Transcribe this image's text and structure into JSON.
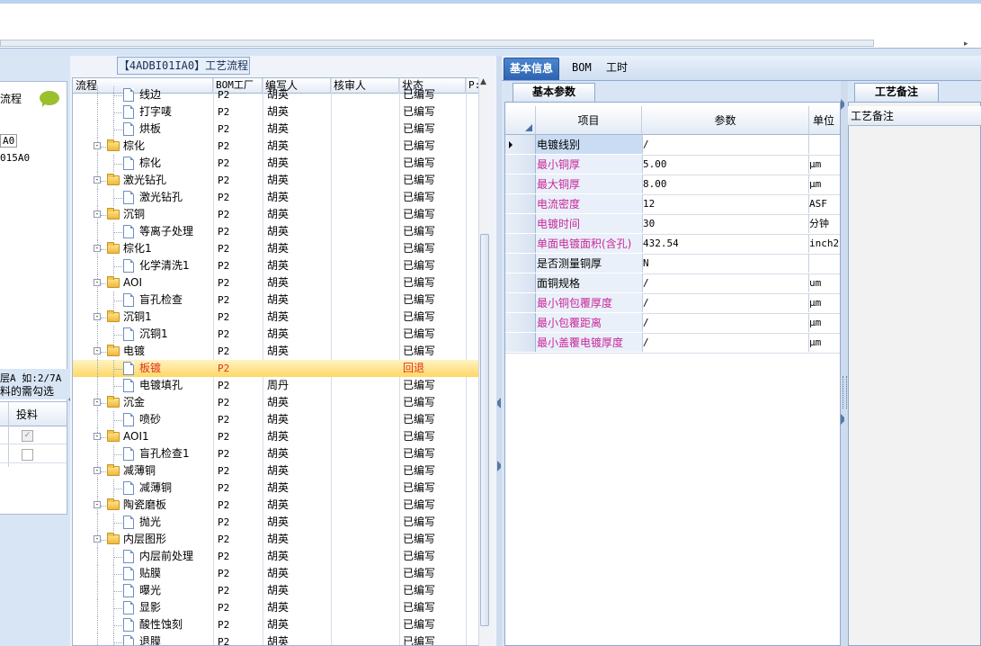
{
  "left": {
    "title_fragment": "流程",
    "line1": "A0",
    "line2": "015A0",
    "note1": "层A 如:2/7A",
    "note2": "料的需勾选",
    "col_header": "投料"
  },
  "tree": {
    "title": "【4ADBI01IA0】工艺流程",
    "columns": [
      "流程",
      "BOM工厂",
      "编写人",
      "核审人",
      "状态",
      "P:"
    ],
    "rows": [
      {
        "name": "线边",
        "level": 2,
        "type": "doc",
        "bom": "P2",
        "writer": "胡英",
        "reviewer": "",
        "status": "已编写"
      },
      {
        "name": "打字唛",
        "level": 2,
        "type": "doc",
        "bom": "P2",
        "writer": "胡英",
        "reviewer": "",
        "status": "已编写"
      },
      {
        "name": "烘板",
        "level": 2,
        "type": "doc",
        "bom": "P2",
        "writer": "胡英",
        "reviewer": "",
        "status": "已编写"
      },
      {
        "name": "棕化",
        "level": 1,
        "type": "folder",
        "bom": "P2",
        "writer": "胡英",
        "reviewer": "",
        "status": "已编写"
      },
      {
        "name": "棕化",
        "level": 2,
        "type": "doc",
        "bom": "P2",
        "writer": "胡英",
        "reviewer": "",
        "status": "已编写"
      },
      {
        "name": "激光钻孔",
        "level": 1,
        "type": "folder",
        "bom": "P2",
        "writer": "胡英",
        "reviewer": "",
        "status": "已编写"
      },
      {
        "name": "激光钻孔",
        "level": 2,
        "type": "doc",
        "bom": "P2",
        "writer": "胡英",
        "reviewer": "",
        "status": "已编写"
      },
      {
        "name": "沉铜",
        "level": 1,
        "type": "folder",
        "bom": "P2",
        "writer": "胡英",
        "reviewer": "",
        "status": "已编写"
      },
      {
        "name": "等离子处理",
        "level": 2,
        "type": "doc",
        "bom": "P2",
        "writer": "胡英",
        "reviewer": "",
        "status": "已编写"
      },
      {
        "name": "棕化1",
        "level": 1,
        "type": "folder",
        "bom": "P2",
        "writer": "胡英",
        "reviewer": "",
        "status": "已编写"
      },
      {
        "name": "化学清洗1",
        "level": 2,
        "type": "doc",
        "bom": "P2",
        "writer": "胡英",
        "reviewer": "",
        "status": "已编写"
      },
      {
        "name": "AOI",
        "level": 1,
        "type": "folder",
        "bom": "P2",
        "writer": "胡英",
        "reviewer": "",
        "status": "已编写"
      },
      {
        "name": "盲孔检查",
        "level": 2,
        "type": "doc",
        "bom": "P2",
        "writer": "胡英",
        "reviewer": "",
        "status": "已编写"
      },
      {
        "name": "沉铜1",
        "level": 1,
        "type": "folder",
        "bom": "P2",
        "writer": "胡英",
        "reviewer": "",
        "status": "已编写"
      },
      {
        "name": "沉铜1",
        "level": 2,
        "type": "doc",
        "bom": "P2",
        "writer": "胡英",
        "reviewer": "",
        "status": "已编写"
      },
      {
        "name": "电镀",
        "level": 1,
        "type": "folder",
        "bom": "P2",
        "writer": "胡英",
        "reviewer": "",
        "status": "已编写"
      },
      {
        "name": "板镀",
        "level": 2,
        "type": "doc",
        "bom": "P2",
        "writer": "",
        "reviewer": "",
        "status": "回退",
        "selected": true
      },
      {
        "name": "电镀填孔",
        "level": 2,
        "type": "doc",
        "bom": "P2",
        "writer": "周丹",
        "reviewer": "",
        "status": "已编写"
      },
      {
        "name": "沉金",
        "level": 1,
        "type": "folder",
        "bom": "P2",
        "writer": "胡英",
        "reviewer": "",
        "status": "已编写"
      },
      {
        "name": "喷砂",
        "level": 2,
        "type": "doc",
        "bom": "P2",
        "writer": "胡英",
        "reviewer": "",
        "status": "已编写"
      },
      {
        "name": "AOI1",
        "level": 1,
        "type": "folder",
        "bom": "P2",
        "writer": "胡英",
        "reviewer": "",
        "status": "已编写"
      },
      {
        "name": "盲孔检查1",
        "level": 2,
        "type": "doc",
        "bom": "P2",
        "writer": "胡英",
        "reviewer": "",
        "status": "已编写"
      },
      {
        "name": "减薄铜",
        "level": 1,
        "type": "folder",
        "bom": "P2",
        "writer": "胡英",
        "reviewer": "",
        "status": "已编写"
      },
      {
        "name": "减薄铜",
        "level": 2,
        "type": "doc",
        "bom": "P2",
        "writer": "胡英",
        "reviewer": "",
        "status": "已编写"
      },
      {
        "name": "陶瓷磨板",
        "level": 1,
        "type": "folder",
        "bom": "P2",
        "writer": "胡英",
        "reviewer": "",
        "status": "已编写"
      },
      {
        "name": "抛光",
        "level": 2,
        "type": "doc",
        "bom": "P2",
        "writer": "胡英",
        "reviewer": "",
        "status": "已编写"
      },
      {
        "name": "内层图形",
        "level": 1,
        "type": "folder",
        "bom": "P2",
        "writer": "胡英",
        "reviewer": "",
        "status": "已编写"
      },
      {
        "name": "内层前处理",
        "level": 2,
        "type": "doc",
        "bom": "P2",
        "writer": "胡英",
        "reviewer": "",
        "status": "已编写"
      },
      {
        "name": "贴膜",
        "level": 2,
        "type": "doc",
        "bom": "P2",
        "writer": "胡英",
        "reviewer": "",
        "status": "已编写"
      },
      {
        "name": "曝光",
        "level": 2,
        "type": "doc",
        "bom": "P2",
        "writer": "胡英",
        "reviewer": "",
        "status": "已编写"
      },
      {
        "name": "显影",
        "level": 2,
        "type": "doc",
        "bom": "P2",
        "writer": "胡英",
        "reviewer": "",
        "status": "已编写"
      },
      {
        "name": "酸性蚀刻",
        "level": 2,
        "type": "doc",
        "bom": "P2",
        "writer": "胡英",
        "reviewer": "",
        "status": "已编写"
      },
      {
        "name": "退膜",
        "level": 2,
        "type": "doc",
        "bom": "P2",
        "writer": "胡英",
        "reviewer": "",
        "status": "已编写"
      }
    ]
  },
  "right": {
    "tabs": [
      "基本信息",
      "BOM",
      "工时"
    ],
    "subtab": "基本参数",
    "columns": [
      "项目",
      "参数",
      "单位"
    ],
    "params": [
      {
        "item": "电镀线别",
        "value": "/",
        "unit": "",
        "highlight": false,
        "current": true
      },
      {
        "item": "最小铜厚",
        "value": "5.00",
        "unit": "μm",
        "highlight": true
      },
      {
        "item": "最大铜厚",
        "value": "8.00",
        "unit": "μm",
        "highlight": true
      },
      {
        "item": "电流密度",
        "value": "12",
        "unit": "ASF",
        "highlight": true
      },
      {
        "item": "电镀时间",
        "value": "30",
        "unit": "分钟",
        "highlight": true
      },
      {
        "item": "单面电镀面积(含孔)",
        "value": "432.54",
        "unit": "inch2",
        "highlight": true
      },
      {
        "item": "是否测量铜厚",
        "value": "N",
        "unit": "",
        "highlight": false
      },
      {
        "item": "面铜规格",
        "value": "/",
        "unit": "um",
        "highlight": false
      },
      {
        "item": "最小铜包覆厚度",
        "value": "/",
        "unit": "μm",
        "highlight": true
      },
      {
        "item": "最小包覆距离",
        "value": "/",
        "unit": "μm",
        "highlight": true
      },
      {
        "item": "最小盖覆电镀厚度",
        "value": "/",
        "unit": "μm",
        "highlight": true
      }
    ],
    "note_tab": "工艺备注",
    "note_header": "工艺备注"
  },
  "colors": {
    "highlight_text": "#c8289a",
    "selected_text": "#e0321e",
    "tab_active": "#2d63b1"
  }
}
